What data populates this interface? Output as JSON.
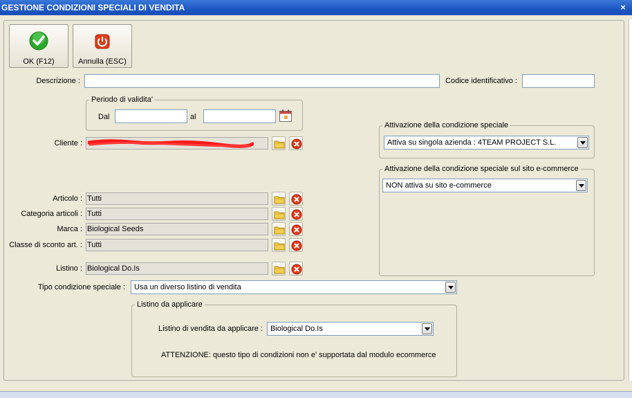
{
  "window": {
    "title": "GESTIONE CONDIZIONI SPECIALI DI VENDITA",
    "close_glyph": "×"
  },
  "toolbar": {
    "ok_label": "OK (F12)",
    "cancel_label": "Annulla (ESC)"
  },
  "descrizione": {
    "label": "Descrizione :",
    "value": ""
  },
  "codice": {
    "label": "Codice identificativo :",
    "value": ""
  },
  "periodo": {
    "title": "Periodo di validita'",
    "dal_label": "Dal",
    "al_label": "al",
    "dal_value": "",
    "al_value": ""
  },
  "cliente": {
    "label": "Cliente :",
    "value": ""
  },
  "articolo": {
    "label": "Articolo :",
    "value": "Tutti"
  },
  "categoria": {
    "label": "Categoria articoli :",
    "value": "Tutti"
  },
  "marca": {
    "label": "Marca :",
    "value": "Biological Seeds"
  },
  "classe": {
    "label": "Classe di sconto art. :",
    "value": "Tutti"
  },
  "listino": {
    "label": "Listino :",
    "value": "Biological Do.Is"
  },
  "tipo": {
    "label": "Tipo condizione speciale :",
    "value": "Usa un diverso listino di vendita"
  },
  "listino_applicare": {
    "title": "Listino da applicare",
    "label": "Listino di vendita da applicare :",
    "value": "Biological Do.Is",
    "warning": "ATTENZIONE: questo tipo di condizioni non e' supportata dal modulo ecommerce"
  },
  "attivazione": {
    "title": "Attivazione della condizione speciale",
    "value": "Attiva su singola azienda : 4TEAM PROJECT S.L."
  },
  "attivazione_ecom": {
    "title": "Attivazione della condizione speciale sul sito e-commerce",
    "value": "NON attiva su sito e-commerce"
  },
  "colors": {
    "titlebar": "#1c56c4",
    "panel": "#ece9d8",
    "ok_green": "#2aa82a",
    "cancel_red": "#e03c1c",
    "redaction": "#ff1a1a"
  },
  "icons": [
    "check-icon",
    "power-icon",
    "calendar-icon",
    "folder-icon",
    "clear-icon",
    "dropdown-arrow-icon"
  ]
}
